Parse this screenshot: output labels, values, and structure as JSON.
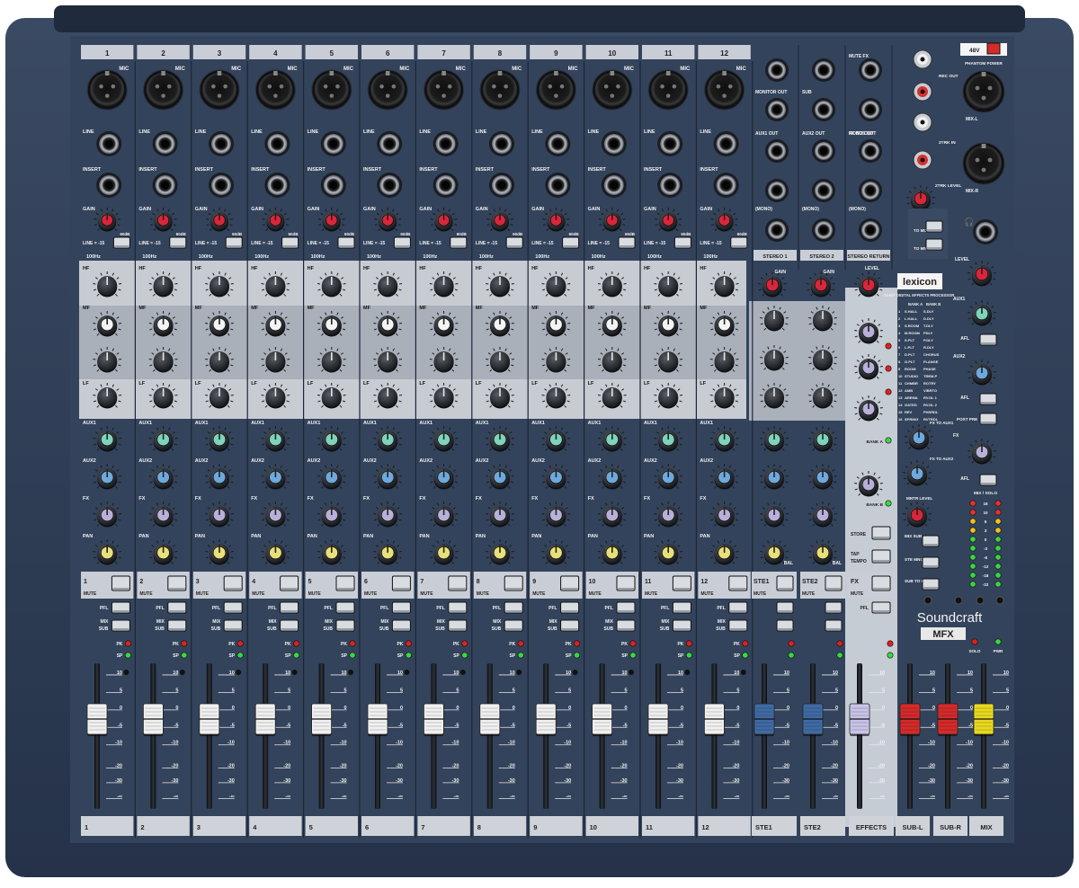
{
  "brand": {
    "name": "Soundcraft",
    "model": "MFX",
    "fx_brand": "lexicon",
    "fx_subtitle": "24-BIT DIGITAL EFFECTS PROCESSOR",
    "logo_color": "#f2f2f2"
  },
  "mono_channels": [
    "1",
    "2",
    "3",
    "4",
    "5",
    "6",
    "7",
    "8",
    "9",
    "10",
    "11",
    "12"
  ],
  "stereo_channels": [
    "STE1",
    "STE2"
  ],
  "top_jack_labels": {
    "mic": "MIC",
    "line": "LINE",
    "insert": "INSERT",
    "gain": "GAIN",
    "line_pad": "LINE = -15",
    "hpf": "100Hz",
    "gain_scale": "60dB"
  },
  "eq_labels": {
    "hf": "HF",
    "mf": "MF",
    "lf": "LF"
  },
  "send_labels": {
    "aux1": "AUX1",
    "aux2": "AUX2",
    "fx": "FX",
    "pan": "PAN",
    "bal": "BAL"
  },
  "strip_buttons": {
    "mute": "MUTE",
    "pfl": "PFL",
    "mix": "MIX",
    "sub": "SUB",
    "pk": "PK",
    "sp": "SP"
  },
  "fader_scale": [
    "10",
    "5",
    "0",
    "-5",
    "-10",
    "-20",
    "-30",
    "-∞"
  ],
  "bottom_labels": [
    "1",
    "2",
    "3",
    "4",
    "5",
    "6",
    "7",
    "8",
    "9",
    "10",
    "11",
    "12",
    "STE1",
    "STE2",
    "EFFECTS",
    "SUB-L",
    "SUB-R",
    "MIX"
  ],
  "stereo_panel": {
    "col1": {
      "top": "MONITOR OUT",
      "mid": "AUX1 OUT",
      "mono": "(MONO)",
      "footer": "STEREO 1",
      "gain": "GAIN"
    },
    "col2": {
      "top": "SUB",
      "mid": "AUX2 OUT",
      "mono": "(MONO)",
      "footer": "STEREO 2",
      "gain": "GAIN"
    },
    "col3": {
      "top": "MUTE FX",
      "mid": "MONO OUT",
      "fxbus": "FX BUS OUT",
      "mono": "(MONO)",
      "footer": "STEREO RETURN",
      "level": "LEVEL"
    }
  },
  "master_panel": {
    "phantom": "48V",
    "phantom_label": "PHANTOM POWER",
    "rec_out": "REC OUT",
    "two_trk_in": "2TRK IN",
    "two_trk_level": "2TRK LEVEL",
    "mix_l": "MIX-L",
    "mix_r": "MIX-R",
    "to_mix": "TO MIX",
    "to_mntr": "TO MNTR",
    "level": "LEVEL",
    "aux1": "AUX1",
    "aux2": "AUX2",
    "afl": "AFL",
    "post_pre": "POST PRE",
    "fx": "FX",
    "mntr_level": "MNTR LEVEL",
    "mix_solo": "MIX / SOLO",
    "meter_scale": [
      "16",
      "10",
      "6",
      "3",
      "0",
      "-3",
      "-6",
      "-12",
      "-18",
      "-22"
    ],
    "mix_sub": "MIX SUB",
    "ste_mno": "STE MNO",
    "sub_to_mix": "SUB TO MIX",
    "solo": "SOLO",
    "pwr": "PWR"
  },
  "fx_panel": {
    "bank_a": "BANK A",
    "bank_b": "BANK B",
    "fx_to_aux1": "FX TO AUX1",
    "fx_to_aux2": "FX TO AUX2",
    "store": "STORE",
    "tap_tempo": "TAP TEMPO",
    "fx_strip": "FX",
    "pfl": "PFL",
    "presets": [
      {
        "n": "1",
        "a": "S.HALL",
        "b": "S.DLY"
      },
      {
        "n": "2",
        "a": "L.HALL",
        "b": "D.DLY"
      },
      {
        "n": "3",
        "a": "S.ROOM",
        "b": "T.DLY"
      },
      {
        "n": "4",
        "a": "M.ROOM",
        "b": "PDLY"
      },
      {
        "n": "5",
        "a": "S.PLT",
        "b": "P.DLY"
      },
      {
        "n": "6",
        "a": "L.PLT",
        "b": "R.DLY"
      },
      {
        "n": "7",
        "a": "D.PLT",
        "b": "CHORUS"
      },
      {
        "n": "8",
        "a": "G.PLT",
        "b": "FLANGE"
      },
      {
        "n": "9",
        "a": "ROOM",
        "b": "PHASE"
      },
      {
        "n": "10",
        "a": "STUDIO",
        "b": "TREM.P"
      },
      {
        "n": "11",
        "a": "CHMBR",
        "b": "ROTRY"
      },
      {
        "n": "12",
        "a": "AMB",
        "b": "VIBRTO"
      },
      {
        "n": "13",
        "a": "AREMA",
        "b": "RV.DL 1"
      },
      {
        "n": "14",
        "a": "GATED",
        "b": "RV.DL 2"
      },
      {
        "n": "15",
        "a": "REV",
        "b": "PHSRDL"
      },
      {
        "n": "16",
        "a": "SPRING",
        "b": "RVTRDL"
      }
    ]
  },
  "colors": {
    "chassis": "#2c3a4f",
    "panel": "#34445c",
    "eq_band": "#c7ccd3",
    "gain_knob": "#d8263a",
    "aux1_knob": "#7fd3bd",
    "aux2_knob": "#6fa8dc",
    "fx_knob": "#b7b0d8",
    "pan_knob": "#e8e07a",
    "fader_mono": "#f0f0f0",
    "fader_stereo": "#3f6aa3",
    "fader_fx": "#c9c3e8",
    "fader_sub": "#d42b2b",
    "fader_mix": "#e8d820"
  }
}
